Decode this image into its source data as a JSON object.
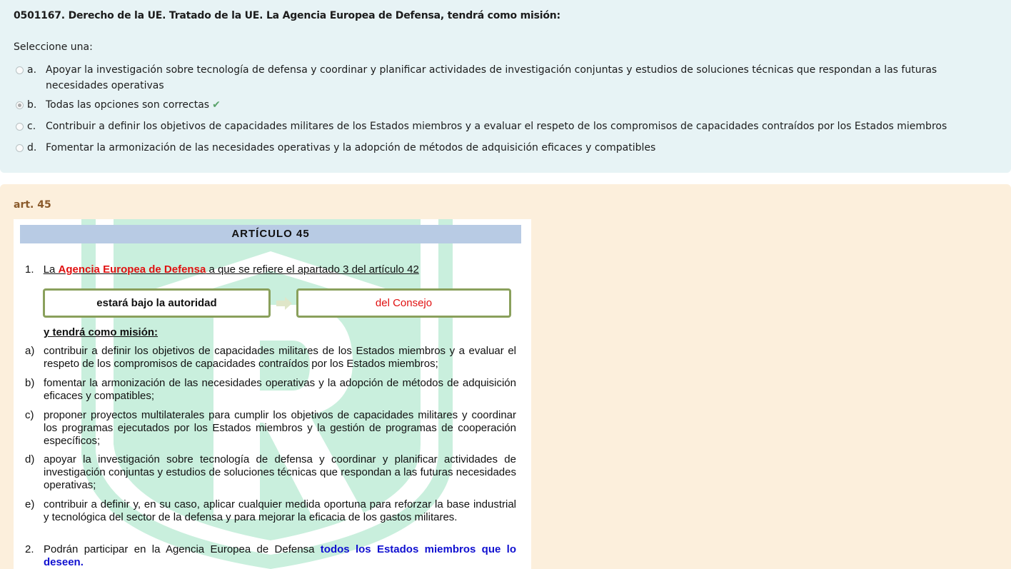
{
  "question": {
    "title": "0501167. Derecho de la UE. Tratado de la UE. La Agencia Europea de Defensa, tendrá como misión:",
    "prompt": "Seleccione una:",
    "options": [
      {
        "letter": "a.",
        "text": "Apoyar la investigación sobre tecnología de defensa y coordinar y planificar actividades de investigación conjuntas y estudios de soluciones técnicas que respondan a las futuras necesidades operativas",
        "selected": false
      },
      {
        "letter": "b.",
        "text": "Todas las opciones son correctas",
        "selected": true,
        "correct_mark": "✔"
      },
      {
        "letter": "c.",
        "text": "Contribuir a definir los objetivos de capacidades militares de los Estados miembros y a evaluar el respeto de los compromisos de capacidades contraídos por los Estados miembros",
        "selected": false
      },
      {
        "letter": "d.",
        "text": "Fomentar la armonización de las necesidades operativas y la adopción de métodos de adquisición eficaces y compatibles",
        "selected": false
      }
    ]
  },
  "feedback": {
    "title": "art. 45",
    "article": {
      "header": "ARTÍCULO 45",
      "p1_num": "1.",
      "p1_pre": "La ",
      "p1_agency": "Agencia Europea de Defensa",
      "p1_post": " a que se refiere el apartado 3 del artículo 42",
      "box_left": "estará bajo la autoridad",
      "box_right": "del Consejo",
      "mision": "y tendrá como misión:",
      "items": [
        {
          "label": "a)",
          "text": "contribuir a definir los objetivos de capacidades militares de los Estados miembros y a evaluar el respeto de los compromisos de capacidades contraídos por los Estados miembros;"
        },
        {
          "label": "b)",
          "text": "fomentar la armonización de las necesidades operativas y la adopción de métodos de adquisición eficaces y compatibles;"
        },
        {
          "label": "c)",
          "text": "proponer proyectos multilaterales para cumplir los objetivos de capacidades militares y coordinar los programas ejecutados por los Estados miembros y la gestión de programas de cooperación específicos;"
        },
        {
          "label": "d)",
          "text": "apoyar la investigación sobre tecnología de defensa y coordinar y planificar actividades de investigación conjuntas y estudios de soluciones técnicas que respondan a las futuras necesidades operativas;"
        },
        {
          "label": "e)",
          "text": "contribuir a definir y, en su caso, aplicar cualquier medida oportuna para reforzar la base industrial y tecnológica del sector de la defensa y para mejorar la eficacia de los gastos militares."
        }
      ],
      "p2_num": "2.",
      "p2_pre": "Podrán participar en la Agencia Europea de Defensa ",
      "p2_emph": "todos los Estados miembros que lo deseen."
    }
  },
  "colors": {
    "question_bg": "#e7f3f5",
    "feedback_bg": "#fcefdc",
    "header_bg": "#b8cbe4",
    "correct": "#5aa36b",
    "agency_red": "#e01010",
    "emph_blue": "#1010d0",
    "box_border": "#8aa05c",
    "watermark": "#c9efdd"
  }
}
